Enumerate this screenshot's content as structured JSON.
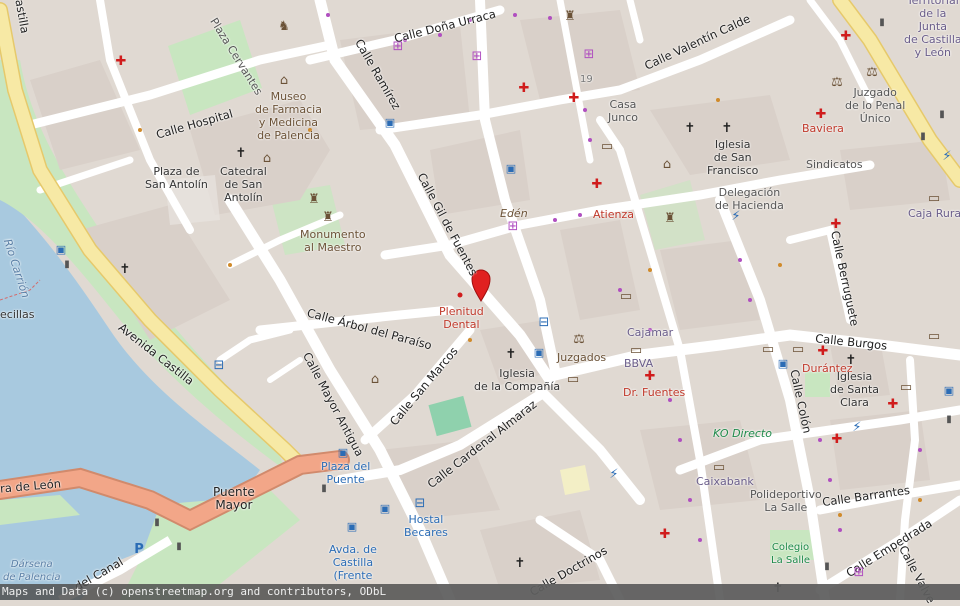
{
  "map": {
    "attribution": "Maps and Data (c) openstreetmap.org and contributors, ODbL",
    "colors": {
      "background": "#e0d9d2",
      "block": "#d9d0c9",
      "road": "#ffffff",
      "primary_road": "#f7e9a5",
      "trunk_road": "#f2a688",
      "water": "#a8c9df",
      "park": "#c8e6c0",
      "pitch": "#8fd1ad",
      "marker": "#e02020",
      "bus": "#2b6cb5",
      "health": "#d01c1c"
    },
    "streets": {
      "calle_dona_urraca": "Calle Doña Urraca",
      "calle_ramirez": "Calle Ramírez",
      "calle_valentin_calderon": "Calle Valentín Calde",
      "calle_hospital": "Calle Hospital",
      "calle_gil_de_fuentes": "Calle Gil de Fuentes",
      "calle_arbol_del_paraiso": "Calle Árbol del Paraíso",
      "calle_san_marcos": "Calle San Marcos",
      "calle_mayor_antigua": "Calle Mayor Antigua",
      "avenida_castilla": "Avenida Castilla",
      "calle_cardenal_almaraz": "Calle Cardenal Almaraz",
      "calle_colon": "Calle Colón",
      "calle_burgos": "Calle Burgos",
      "calle_berruguete": "Calle Berruguete",
      "calle_barrantes": "Calle Barrantes",
      "calle_empedrada": "Calle Empedrada",
      "calle_doctrinos": "Calle Doctrinos",
      "calle_del_canal": "del Canal",
      "calle_valverde": "Calle Valve",
      "castilla_top": "Castilla",
      "carretera_de_leon": "ra de León",
      "rio_carrion": "Río Carrión"
    },
    "places": {
      "plaza_cervantes": "Plaza Cervantes",
      "museo": "Museo\nde Farmacia\ny Medicina\nde Palencia",
      "plaza_san_antolin": "Plaza de\nSan Antolín",
      "catedral": "Catedral\nde San\nAntolín",
      "monumento": "Monumento\nal Maestro",
      "casa_junco": "Casa\nJunco",
      "iglesia_san_francisco": "Iglesia\nde San\nFrancisco",
      "delegacion_hacienda": "Delegación\nde Hacienda",
      "juzgado_penal": "Juzgado\nde lo Penal\nÚnico",
      "sindicatos": "Sindicatos",
      "junta_castilla": "Territorial\nde la\nJunta\nde Castilla\ny León",
      "caja_rural": "Caja Rural",
      "baviera": "Baviera",
      "eden": "Edén",
      "atienza": "Atienza",
      "plenitud_dental": "Plenitud\nDental",
      "cajamar": "Cajamar",
      "juzgados": "Juzgados",
      "bbva": "BBVA",
      "dr_fuentes": "Dr. Fuentes",
      "iglesia_compania": "Iglesia\nde la Compañía",
      "durantez": "Durántez",
      "iglesia_santa_clara": "Iglesia\nde Santa\nClara",
      "ko_directo": "KO Directo",
      "caixabank": "Caixabank",
      "polideportivo": "Polideportivo\nLa Salle",
      "colegio_la_salle": "Colegio\nLa Salle",
      "plaza_del_puente": "Plaza del\nPuente",
      "puente_mayor": "Puente\nMayor",
      "hostal_becares": "Hostal\nBecares",
      "avda_castilla_stop": "Avda. de\nCastilla\n(Frente",
      "darsena": "Dársena\nde Palencia",
      "cecillas": "ecillas",
      "number_19": "19"
    },
    "icons": {
      "church": "church-icon",
      "pharmacy": "pharmacy-cross-icon",
      "bus": "bus-stop-icon",
      "bank": "bank-icon",
      "monument": "monument-icon",
      "museum": "museum-icon",
      "shop": "shopping-cart-icon",
      "parking": "parking-icon",
      "traffic_light": "traffic-light-icon",
      "fuel": "charging-station-icon",
      "marker": "location-marker-icon"
    }
  }
}
